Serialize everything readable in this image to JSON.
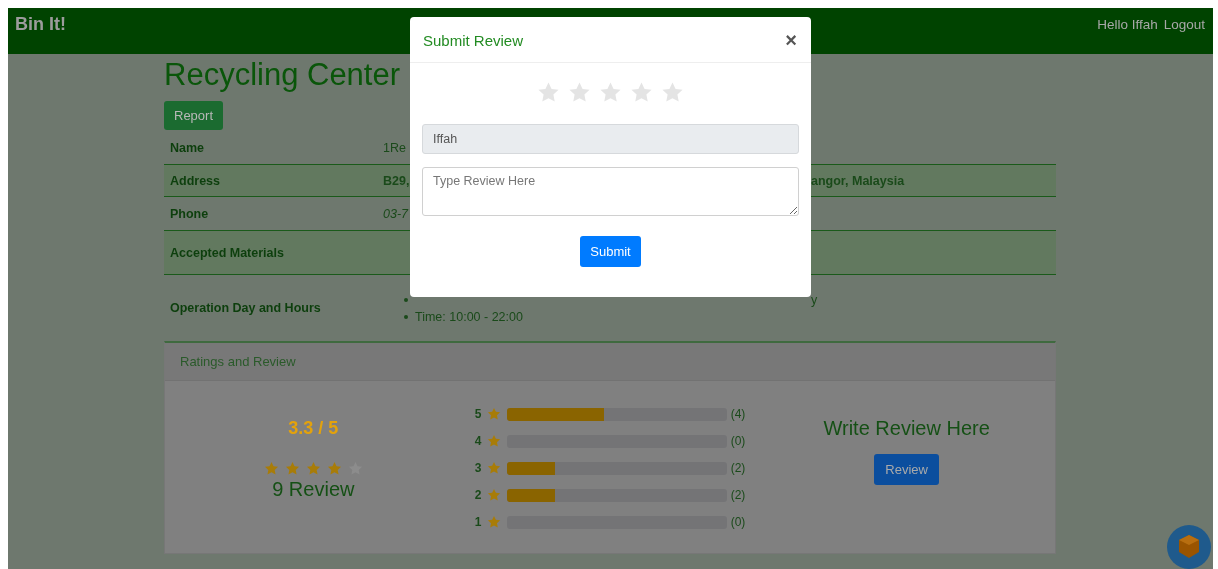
{
  "navbar": {
    "brand": "Bin It!",
    "greeting": "Hello Iffah",
    "logout": "Logout"
  },
  "page": {
    "title": "Recycling Center",
    "report_button": "Report"
  },
  "details": [
    {
      "label": "Name",
      "kind": "plain",
      "value_start": "1Re"
    },
    {
      "label": "Address",
      "kind": "bold",
      "value_start": "B29,",
      "value_end": "angor, Malaysia"
    },
    {
      "label": "Phone",
      "kind": "italic",
      "value_start": "03-7"
    },
    {
      "label": "Accepted Materials",
      "kind": "hidden"
    },
    {
      "label": "Operation Day and Hours",
      "kind": "list",
      "items": [
        {
          "value_end": "y"
        },
        {
          "value_start": "Time: 10:00 - 22:00"
        }
      ]
    }
  ],
  "ratings": {
    "header": "Ratings and Review",
    "average": "3.3 / 5",
    "stars": 4,
    "count": "9 Review",
    "breakdown": [
      {
        "label": "5",
        "level": 0.444,
        "count": "(4)"
      },
      {
        "label": "4",
        "level": 0,
        "count": "(0)"
      },
      {
        "label": "3",
        "level": 0.222,
        "count": "(2)"
      },
      {
        "label": "2",
        "level": 0.222,
        "count": "(2)"
      },
      {
        "label": "1",
        "level": 0,
        "count": "(0)"
      }
    ],
    "write_title": "Write Review Here",
    "review_button": "Review"
  },
  "modal": {
    "title": "Submit Review",
    "close": "×",
    "stars": 0,
    "name_value": "Iffah",
    "review_placeholder": "Type Review Here",
    "submit": "Submit"
  }
}
